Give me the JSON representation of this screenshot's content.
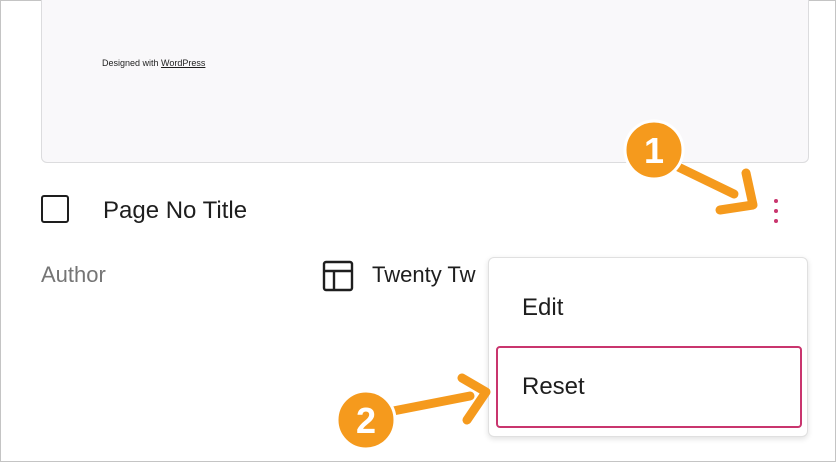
{
  "preview": {
    "footer_prefix": "Designed with ",
    "footer_link": "WordPress"
  },
  "item": {
    "title": "Page No Title",
    "author_label": "Author",
    "template_name": "Twenty Tw"
  },
  "menu": {
    "items": [
      {
        "label": "Edit"
      },
      {
        "label": "Reset"
      }
    ]
  },
  "annotations": {
    "step1": "1",
    "step2": "2"
  },
  "colors": {
    "accent": "#c9356e",
    "callout": "#f59a1d"
  },
  "icons": {
    "more": "vertical-ellipsis-icon",
    "template": "layout-icon"
  }
}
